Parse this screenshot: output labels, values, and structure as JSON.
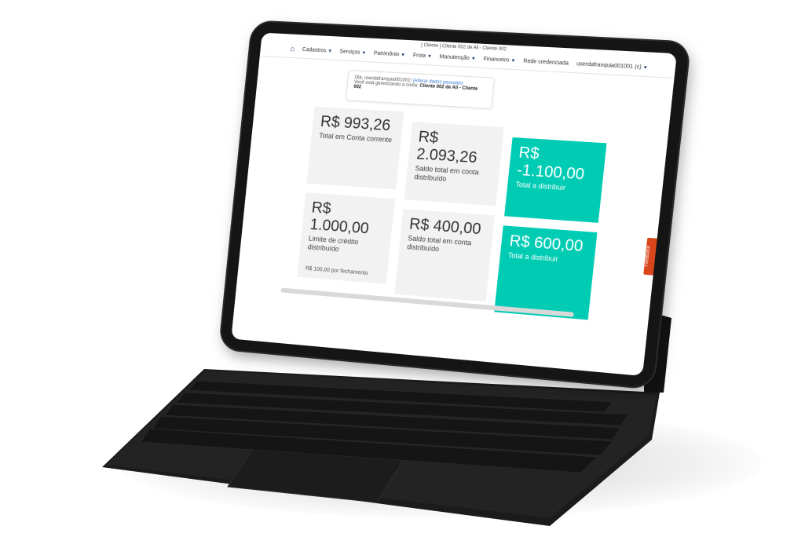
{
  "header": {
    "client_line": "[ Cliente ] Cliente 002 de All - Cliente 002",
    "nav": [
      {
        "label": "Cadastros"
      },
      {
        "label": "Serviços"
      },
      {
        "label": "Patrimônio"
      },
      {
        "label": "Frota"
      },
      {
        "label": "Manutenção"
      },
      {
        "label": "Financeiro"
      },
      {
        "label": "Rede credenciada"
      },
      {
        "label": "userdafranquia001001 (c)"
      }
    ]
  },
  "welcome": {
    "greeting": "Olá, userdafranquia001001!",
    "link": "(Alterar dados pessoais)",
    "managing_prefix": "Você está gerenciando a conta:",
    "account": "Cliente 002 de All - Cliente 002"
  },
  "cards": [
    {
      "amount": "R$ 993,26",
      "label": "Total em Conta corrente",
      "note": ""
    },
    {
      "amount": "R$ 2.093,26",
      "label": "Saldo total em conta distribuído",
      "note": ""
    },
    {
      "amount": "R$ -1.100,00",
      "label": "Total a distribuir",
      "note": ""
    },
    {
      "amount": "R$ 1.000,00",
      "label": "Limite de crédito distribuído",
      "note": "R$ 100,00 por fechamento"
    },
    {
      "amount": "R$ 400,00",
      "label": "Saldo total em conta distribuído",
      "note": ""
    },
    {
      "amount": "R$ 600,00",
      "label": "Total a distribuir",
      "note": ""
    }
  ],
  "feedback": "Feedback",
  "colors": {
    "accent": "#00ccb4",
    "card_bg": "#f2f2f2",
    "feedback": "#d9461b",
    "nav_blue": "#1b3a6b"
  }
}
